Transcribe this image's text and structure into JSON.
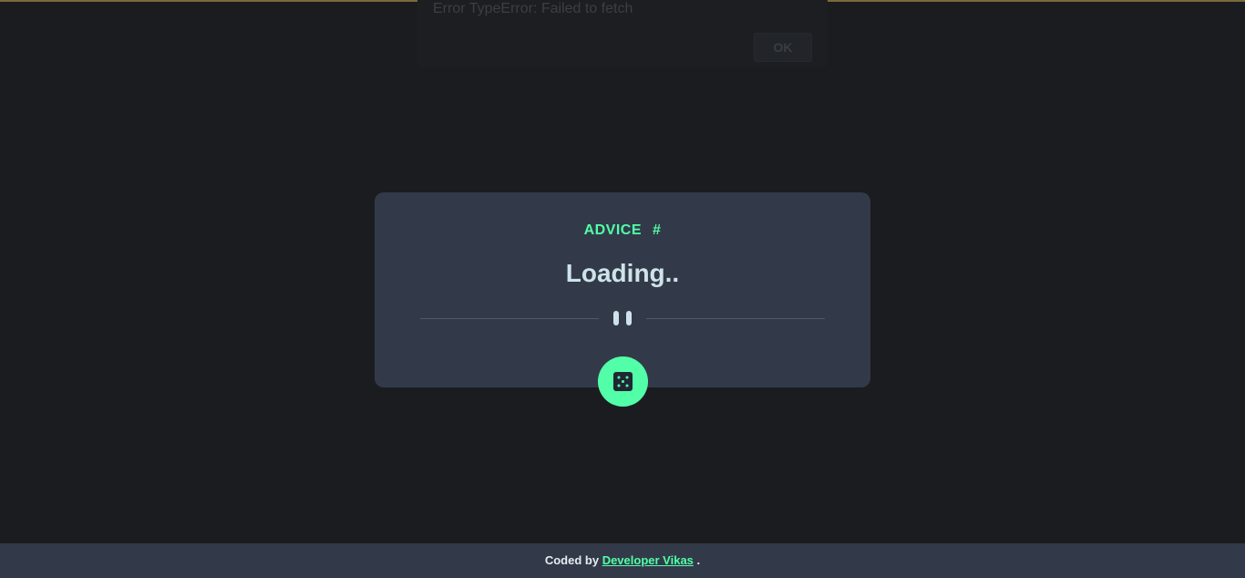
{
  "alert": {
    "message": "Error TypeError: Failed to fetch",
    "ok_label": "OK"
  },
  "card": {
    "label": "ADVICE",
    "number": "#",
    "quote": "Loading..",
    "dice_icon": "dice-icon",
    "pause_icon": "pause-divider-icon"
  },
  "footer": {
    "prefix": "Coded by",
    "author": "Developer Vikas",
    "suffix": "."
  },
  "colors": {
    "accent": "#52ffa8",
    "card_bg": "#323a49",
    "page_bg": "#1b1c1f",
    "text_light": "#cee3e9"
  }
}
